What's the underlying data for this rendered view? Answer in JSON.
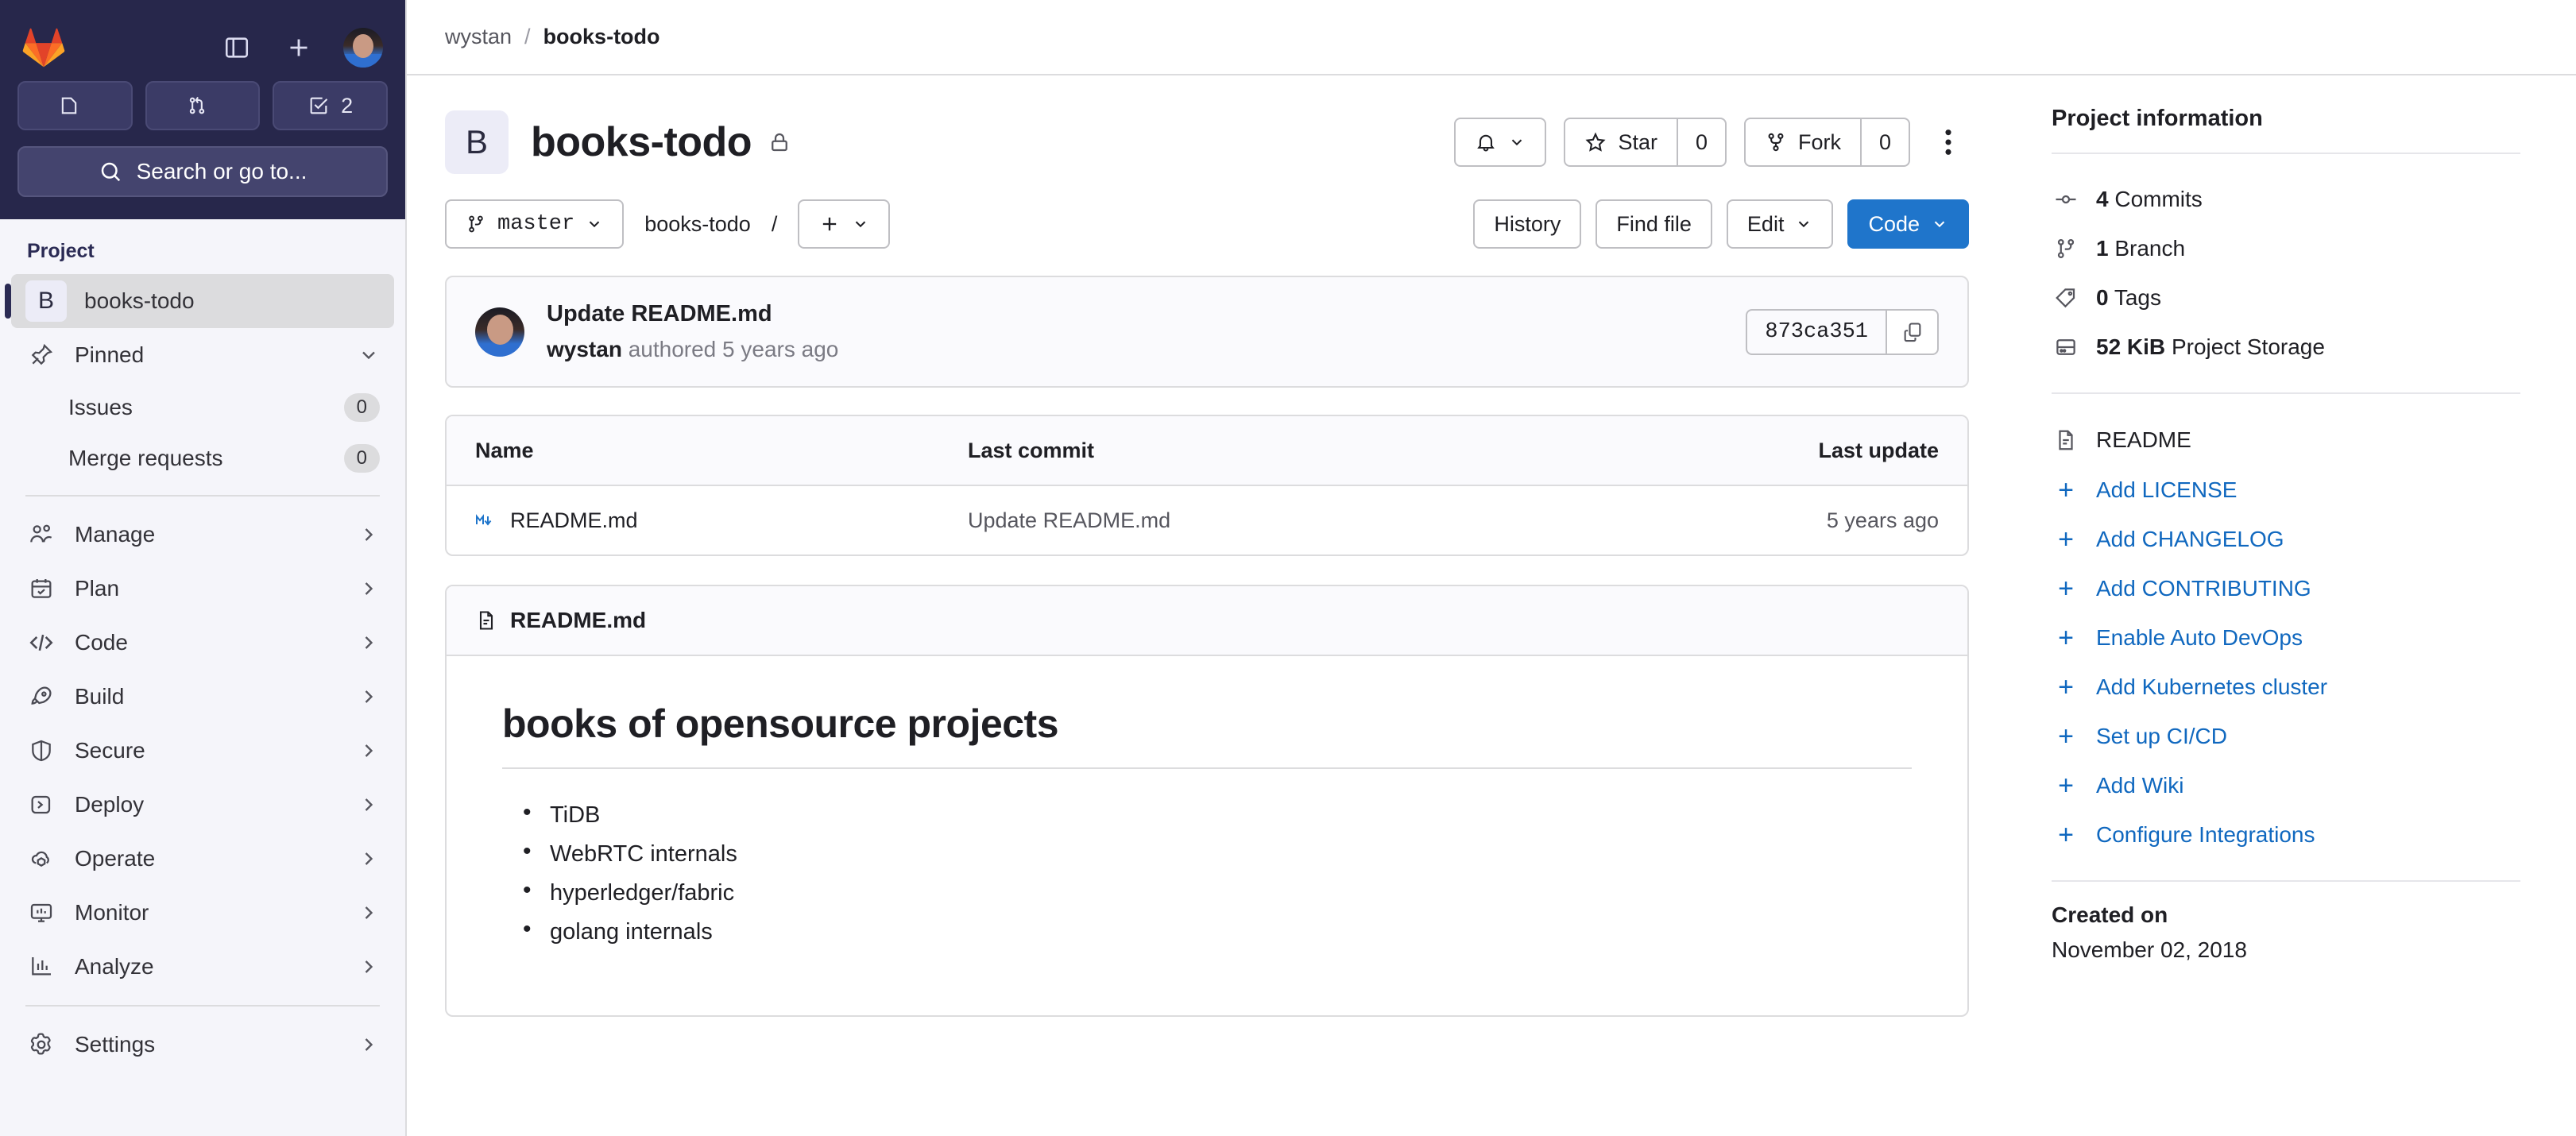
{
  "sidebar": {
    "brand_icon": "gitlab-logo",
    "top_icons": [
      {
        "name": "toggle-sidebar-icon",
        "label": ""
      },
      {
        "name": "create-new-icon",
        "label": ""
      }
    ],
    "avatar_name": "user-avatar",
    "counts": [
      {
        "name": "issues-count-pill",
        "icon": "issue-icon",
        "value": ""
      },
      {
        "name": "merge-requests-count-pill",
        "icon": "merge-request-icon",
        "value": ""
      },
      {
        "name": "todos-count-pill",
        "icon": "todo-check-icon",
        "value": "2"
      }
    ],
    "search_placeholder": "Search or go to...",
    "section_title": "Project",
    "project": {
      "initial": "B",
      "name": "books-todo"
    },
    "pinned": {
      "label": "Pinned",
      "icon": "pin-icon",
      "chevron": "chevron-down-icon"
    },
    "pinned_items": [
      {
        "label": "Issues",
        "count": "0"
      },
      {
        "label": "Merge requests",
        "count": "0"
      }
    ],
    "nav_items": [
      {
        "label": "Manage",
        "icon": "users-icon"
      },
      {
        "label": "Plan",
        "icon": "calendar-icon"
      },
      {
        "label": "Code",
        "icon": "code-icon"
      },
      {
        "label": "Build",
        "icon": "rocket-icon"
      },
      {
        "label": "Secure",
        "icon": "shield-icon"
      },
      {
        "label": "Deploy",
        "icon": "deploy-icon"
      },
      {
        "label": "Operate",
        "icon": "cloud-cube-icon"
      },
      {
        "label": "Monitor",
        "icon": "monitor-icon"
      },
      {
        "label": "Analyze",
        "icon": "chart-icon"
      }
    ],
    "settings": {
      "label": "Settings",
      "icon": "gear-icon"
    }
  },
  "breadcrumb": {
    "owner": "wystan",
    "separator": "/",
    "current": "books-todo"
  },
  "project_header": {
    "initial": "B",
    "title": "books-todo",
    "visibility_icon": "lock-icon",
    "notifications": {
      "icon": "bell-icon",
      "chevron": "chevron-down-icon"
    },
    "star": {
      "label": "Star",
      "icon": "star-icon",
      "count": "0"
    },
    "fork": {
      "label": "Fork",
      "icon": "fork-icon",
      "count": "0"
    },
    "more_icon": "kebab-vertical-icon"
  },
  "toolbar": {
    "branch": {
      "icon": "branch-icon",
      "name": "master",
      "chevron": "chevron-down-icon"
    },
    "path_root": "books-todo",
    "path_sep": "/",
    "add_button": {
      "icon": "plus-icon",
      "chevron": "chevron-down-icon"
    },
    "history_label": "History",
    "find_file_label": "Find file",
    "edit_label": "Edit",
    "edit_chevron": "chevron-down-icon",
    "code_label": "Code",
    "code_chevron": "chevron-down-icon"
  },
  "commit": {
    "avatar": "commit-author-avatar",
    "title": "Update README.md",
    "author": "wystan",
    "meta": "authored 5 years ago",
    "sha": "873ca351",
    "copy_icon": "copy-icon"
  },
  "files": {
    "headers": {
      "name": "Name",
      "last_commit": "Last commit",
      "last_update": "Last update"
    },
    "rows": [
      {
        "icon": "markdown-icon",
        "name": "README.md",
        "last_commit": "Update README.md",
        "last_update": "5 years ago"
      }
    ]
  },
  "readme": {
    "header_icon": "document-icon",
    "header_title": "README.md",
    "heading": "books of opensource projects",
    "items": [
      "TiDB",
      "WebRTC internals",
      "hyperledger/fabric",
      "golang internals"
    ]
  },
  "project_info": {
    "title": "Project information",
    "stats": [
      {
        "icon": "commit-icon",
        "value": "4",
        "label": "Commits"
      },
      {
        "icon": "branch-icon",
        "value": "1",
        "label": "Branch"
      },
      {
        "icon": "tag-icon",
        "value": "0",
        "label": "Tags"
      },
      {
        "icon": "storage-icon",
        "value": "52 KiB",
        "label": "Project Storage"
      }
    ],
    "readme_link": {
      "icon": "document-icon",
      "label": "README"
    },
    "links": [
      {
        "label": "Add LICENSE"
      },
      {
        "label": "Add CHANGELOG"
      },
      {
        "label": "Add CONTRIBUTING"
      },
      {
        "label": "Enable Auto DevOps"
      },
      {
        "label": "Add Kubernetes cluster"
      },
      {
        "label": "Set up CI/CD"
      },
      {
        "label": "Add Wiki"
      },
      {
        "label": "Configure Integrations"
      }
    ],
    "created_label": "Created on",
    "created_date": "November 02, 2018"
  },
  "colors": {
    "sidebar_dark": "#27274b",
    "sidebar_light": "#f5f5fa",
    "primary_blue": "#1f75cb",
    "link_blue": "#1068bf",
    "border": "#dcdcde",
    "gitlab_orange": "#e24329"
  }
}
